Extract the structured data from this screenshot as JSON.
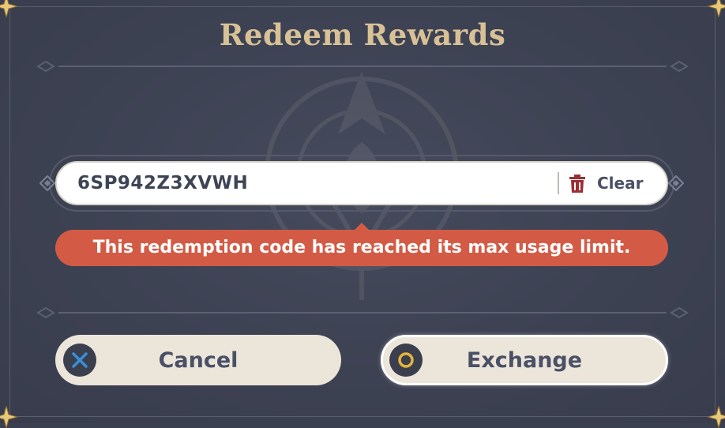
{
  "dialog": {
    "title": "Redeem Rewards"
  },
  "redeem": {
    "code_value": "6SP942Z3XVWH",
    "clear_label": "Clear",
    "error_message": "This redemption code has reached its max usage limit."
  },
  "actions": {
    "cancel_label": "Cancel",
    "exchange_label": "Exchange"
  },
  "icons": {
    "clear": "trash-icon",
    "cancel": "cross-button-icon",
    "exchange": "circle-button-icon",
    "decor": "diamond-icon"
  },
  "colors": {
    "background": "#3d4253",
    "title": "#d8c196",
    "error": "#d35b45",
    "button": "#ece5da",
    "button_text": "#4a5065",
    "trash": "#9b2f33",
    "cross": "#3a8fd6",
    "circle": "#e2b53a"
  }
}
